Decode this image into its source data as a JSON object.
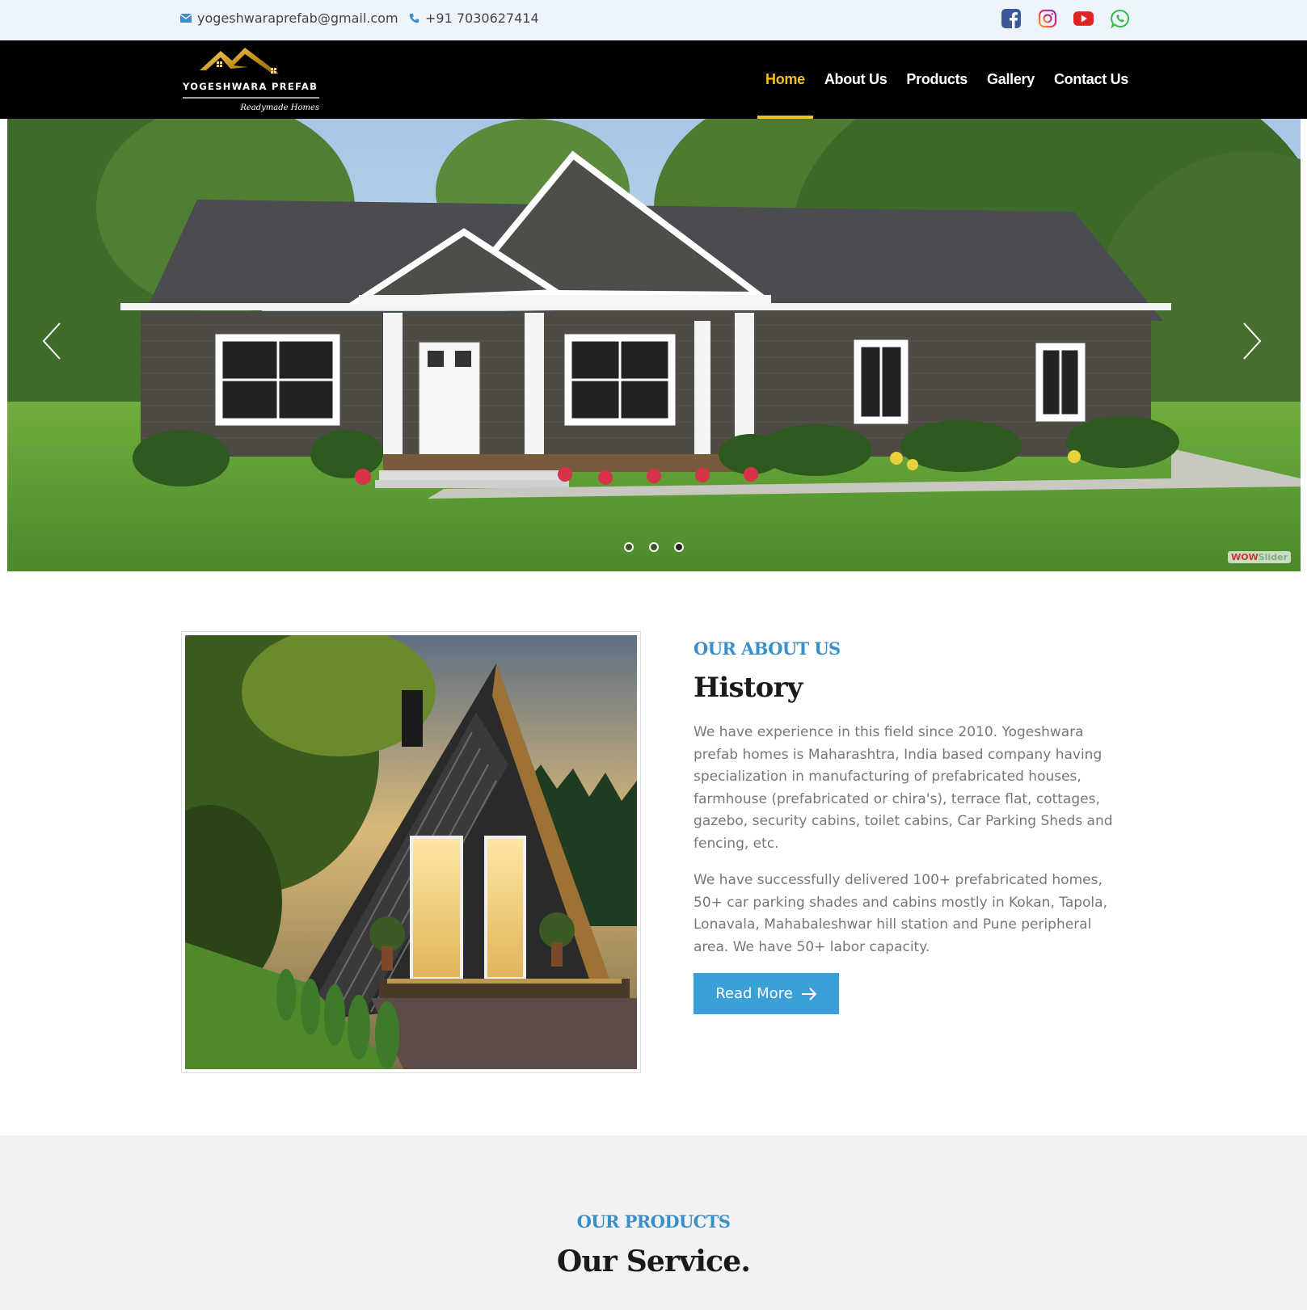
{
  "topbar": {
    "email": "yogeshwaraprefab@gmail.com",
    "phone": "+91 7030627414",
    "socials": [
      {
        "name": "facebook-icon",
        "color": "#3b5998"
      },
      {
        "name": "instagram-icon",
        "color": "#d6249f"
      },
      {
        "name": "youtube-icon",
        "color": "#e02424"
      },
      {
        "name": "whatsapp-icon",
        "color": "#2fbf4a"
      }
    ]
  },
  "header": {
    "logo_name": "YOGESHWARA PREFAB",
    "logo_tagline": "Readymade Homes",
    "nav": [
      {
        "label": "Home",
        "active": true
      },
      {
        "label": "About Us",
        "active": false
      },
      {
        "label": "Products",
        "active": false
      },
      {
        "label": "Gallery",
        "active": false
      },
      {
        "label": "Contact Us",
        "active": false
      }
    ]
  },
  "hero": {
    "slides": 3,
    "active_slide": 3,
    "watermark": "WOWSlider"
  },
  "about": {
    "eyebrow": "OUR ABOUT US",
    "title": "History",
    "paragraphs": [
      "We have experience in this field since 2010. Yogeshwara prefab homes is Maharashtra, India based company having specialization in manufacturing of prefabricated houses, farmhouse (prefabricated or chira's), terrace flat, cottages, gazebo, security cabins, toilet cabins, Car Parking Sheds and fencing, etc.",
      "We have successfully delivered 100+ prefabricated homes, 50+ car parking shades and cabins mostly in Kokan, Tapola, Lonavala, Mahabaleshwar hill station and Pune peripheral area. We have 50+ labor capacity."
    ],
    "button": "Read More"
  },
  "products": {
    "eyebrow": "OUR PRODUCTS",
    "title": "Our Service."
  },
  "colors": {
    "accent_blue": "#3aa0d8",
    "nav_active": "#f5c21b",
    "header_bg": "#000000"
  }
}
